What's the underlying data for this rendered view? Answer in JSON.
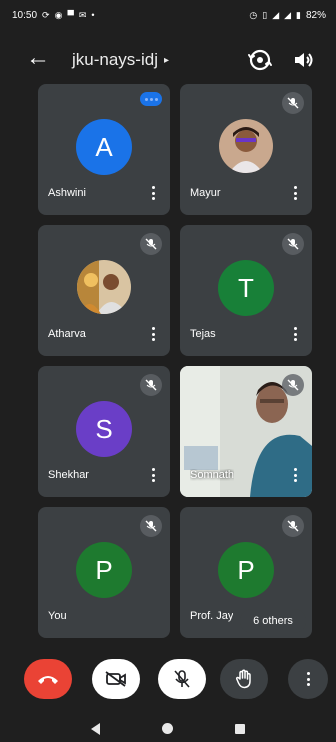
{
  "status": {
    "time": "10:50",
    "battery": "82%",
    "left_icons": [
      "sync-icon",
      "circle-icon",
      "message-icon",
      "mail-icon",
      "dot"
    ],
    "right_icons": [
      "alarm-icon",
      "vibrate-icon",
      "wifi-icon",
      "signal-icon",
      "battery-icon"
    ]
  },
  "header": {
    "title": "jku-nays-idj",
    "caret": "▸"
  },
  "participants": [
    {
      "name": "Ashwini",
      "initial": "A",
      "avatar_color": "#1a73e8",
      "muted": false,
      "speaking": true
    },
    {
      "name": "Mayur",
      "initial": "",
      "avatar_color": "",
      "muted": true,
      "speaking": false,
      "has_photo": true
    },
    {
      "name": "Atharva",
      "initial": "",
      "avatar_color": "",
      "muted": true,
      "speaking": false,
      "has_photo": true
    },
    {
      "name": "Tejas",
      "initial": "T",
      "avatar_color": "#188038",
      "muted": true,
      "speaking": false
    },
    {
      "name": "Shekhar",
      "initial": "S",
      "avatar_color": "#6a3ec7",
      "muted": true,
      "speaking": false
    },
    {
      "name": "Somnath",
      "initial": "",
      "avatar_color": "",
      "muted": true,
      "speaking": false,
      "has_video": true
    },
    {
      "name": "You",
      "initial": "P",
      "avatar_color": "#1e7a2f",
      "muted": true,
      "speaking": false
    },
    {
      "name": "Prof. Jay",
      "initial": "P",
      "avatar_color": "#1e7a2f",
      "muted": true,
      "speaking": false
    }
  ],
  "others": "6 others",
  "controls": [
    {
      "name": "end-call",
      "icon": "phone-hangup-icon",
      "color": "#ea4335"
    },
    {
      "name": "camera-off",
      "icon": "video-off-icon",
      "color": "#ffffff"
    },
    {
      "name": "mic-off",
      "icon": "mic-off-icon",
      "color": "#ffffff"
    },
    {
      "name": "raise-hand",
      "icon": "hand-icon",
      "color": "#3c4043"
    },
    {
      "name": "more",
      "icon": "more-vert-icon",
      "color": "#3c4043"
    }
  ],
  "colors": {
    "background": "#1f1f1f",
    "tile": "#3c4043",
    "accent": "#1a73e8",
    "danger": "#ea4335"
  }
}
